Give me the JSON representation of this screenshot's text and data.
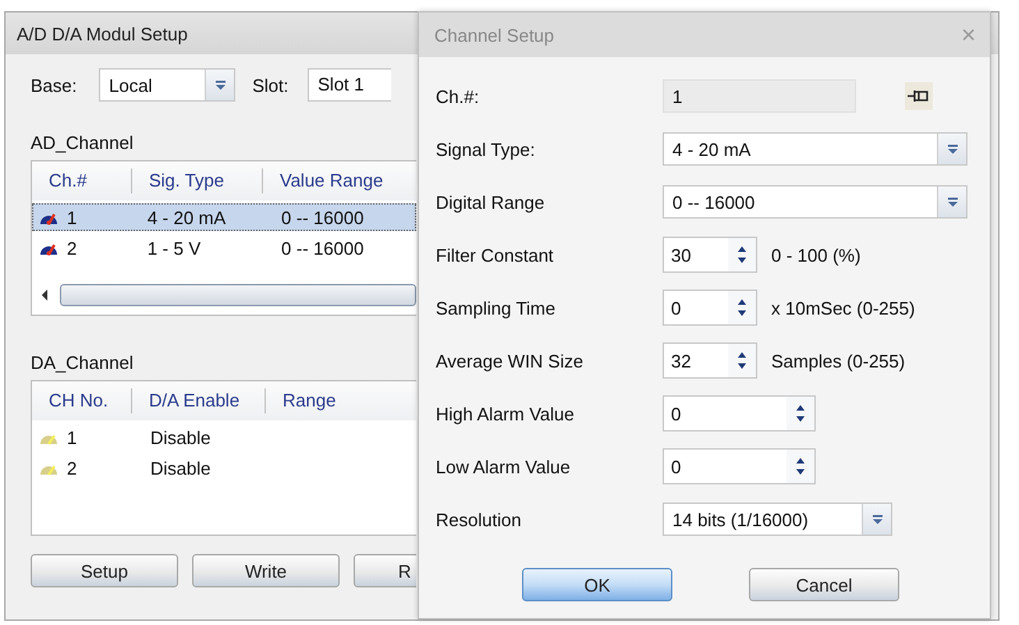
{
  "main_window": {
    "title": "A/D D/A Modul Setup",
    "base": {
      "label": "Base:",
      "value": "Local"
    },
    "slot": {
      "label": "Slot:",
      "value": "Slot 1"
    },
    "ad_channel": {
      "title": "AD_Channel",
      "columns": [
        "Ch.#",
        "Sig. Type",
        "Value Range"
      ],
      "rows": [
        {
          "ch": "1",
          "sig_type": "4 - 20 mA",
          "value_range": "0 -- 16000",
          "selected": true
        },
        {
          "ch": "2",
          "sig_type": "1 - 5 V",
          "value_range": "0 -- 16000",
          "selected": false
        }
      ]
    },
    "da_channel": {
      "title": "DA_Channel",
      "columns": [
        "CH No.",
        "D/A Enable",
        "Range"
      ],
      "rows": [
        {
          "ch": "1",
          "enable": "Disable"
        },
        {
          "ch": "2",
          "enable": "Disable"
        }
      ]
    },
    "buttons": [
      "Setup",
      "Write",
      "R"
    ]
  },
  "dialog": {
    "title": "Channel Setup",
    "close": "×",
    "channel": {
      "label": "Ch.#:",
      "value": "1"
    },
    "fields": [
      {
        "kind": "combo",
        "label": "Signal Type:",
        "value": "4 - 20 mA"
      },
      {
        "kind": "combo",
        "label": "Digital Range",
        "value": "0 -- 16000"
      },
      {
        "kind": "spin",
        "label": "Filter Constant",
        "value": "30",
        "unit": "0 - 100 (%)"
      },
      {
        "kind": "spin",
        "label": "Sampling Time",
        "value": "0",
        "unit": "x 10mSec (0-255)"
      },
      {
        "kind": "spin",
        "label": "Average WIN Size",
        "value": "32",
        "unit": "Samples (0-255)"
      },
      {
        "kind": "longspin",
        "label": "High Alarm Value",
        "value": "0"
      },
      {
        "kind": "longspin",
        "label": "Low Alarm Value",
        "value": "0"
      },
      {
        "kind": "picker",
        "label": "Resolution",
        "value": "14 bits (1/16000)"
      }
    ],
    "buttons": [
      {
        "label": "OK",
        "focused": true
      },
      {
        "label": "Cancel",
        "focused": false
      }
    ]
  }
}
